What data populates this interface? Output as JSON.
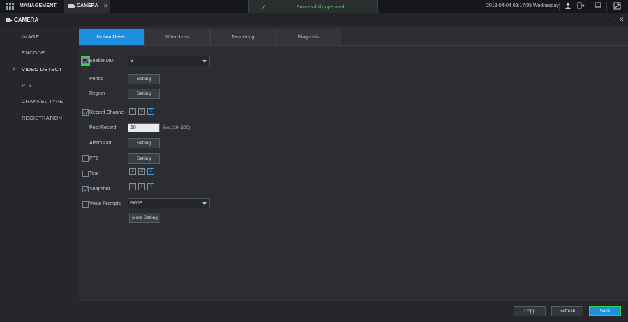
{
  "topbar": {
    "management_label": "MANAGEMENT",
    "camera_tab_label": "CAMERA",
    "close_glyph": "✕",
    "toast_message": "Successfully operated!",
    "datetime": "2018-04-04 09:17:05 Wednesday",
    "icons": [
      "user-icon",
      "logout-icon",
      "monitor-icon",
      "export-icon"
    ]
  },
  "section": {
    "title": "CAMERA",
    "minimize": "–",
    "close": "✕"
  },
  "sidebar": {
    "items": [
      {
        "label": "IMAGE",
        "active": false
      },
      {
        "label": "ENCODE",
        "active": false
      },
      {
        "label": "VIDEO DETECT",
        "active": true
      },
      {
        "label": "PTZ",
        "active": false
      },
      {
        "label": "CHANNEL TYPE",
        "active": false
      },
      {
        "label": "REGISTRATION",
        "active": false
      }
    ]
  },
  "tabs": [
    {
      "label": "Motion Detect",
      "active": true
    },
    {
      "label": "Video Loss",
      "active": false
    },
    {
      "label": "Tampering",
      "active": false
    },
    {
      "label": "Diagnosis",
      "active": false
    }
  ],
  "form": {
    "enable_md": {
      "label": "Enable MD",
      "checked": true,
      "channel_value": "3"
    },
    "period": {
      "label": "Period",
      "button": "Setting"
    },
    "region": {
      "label": "Region",
      "button": "Setting"
    },
    "record_channel": {
      "label": "Record Channel",
      "checked": true,
      "channels": [
        "1",
        "2",
        "3"
      ],
      "selected": "3"
    },
    "post_record": {
      "label": "Post Record",
      "value": "10",
      "hint": "Sec.(10~300)"
    },
    "alarm_out": {
      "label": "Alarm Out",
      "button": "Setting"
    },
    "ptz": {
      "label": "PTZ",
      "checked": false,
      "button": "Setting"
    },
    "tour": {
      "label": "Tour",
      "checked": false,
      "channels": [
        "1",
        "2",
        "3"
      ],
      "selected": "3"
    },
    "snapshot": {
      "label": "Snapshot",
      "checked": true,
      "channels": [
        "1",
        "2",
        "3"
      ],
      "selected": "3"
    },
    "voice_prompts": {
      "label": "Voice Prompts",
      "checked": false,
      "value": "None"
    },
    "more_setting": "More Setting"
  },
  "footer": {
    "copy": "Copy",
    "refresh": "Refresh",
    "save": "Save"
  },
  "colors": {
    "accent": "#1e8fe0",
    "highlight": "#2fd646",
    "toast_text": "#58c865"
  }
}
